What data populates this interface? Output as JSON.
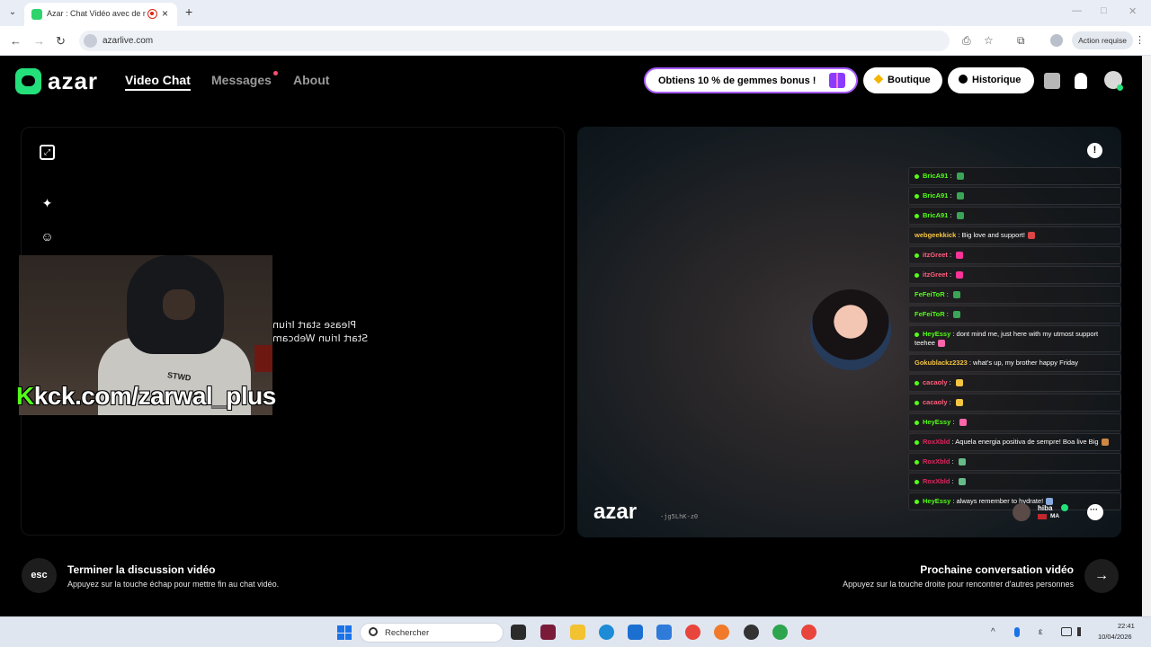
{
  "browser": {
    "tab_title": "Azar : Chat Vidéo avec de n",
    "new_tab": "+",
    "tab_close": "×",
    "menu_glyph": "⌄",
    "back": "←",
    "forward": "→",
    "reload": "↻",
    "url": "azarlive.com",
    "action_required": "Action requise",
    "kebab": "⋮",
    "minimize": "—",
    "maximize": "□",
    "close": "✕",
    "toolbar_glyphs": [
      "⎙",
      "☆",
      "⧉"
    ]
  },
  "header": {
    "logo_text": "azar",
    "nav": [
      {
        "label": "Video Chat"
      },
      {
        "label": "Messages"
      },
      {
        "label": "About"
      }
    ],
    "promo_label": "Obtiens 10 % de gemmes bonus !",
    "shop_label": "Boutique",
    "history_label": "Historique"
  },
  "left_panel": {
    "overlay_link_k": "K",
    "overlay_link_rest": "kck.com/zarwal_plus",
    "sweater_text": "STWD",
    "mirrored_line1": "Please start Iriun",
    "mirrored_line2": "Start Iriun Webcam",
    "expand_glyph": "⤢",
    "magic_glyph": "✦",
    "emoji_glyph": "☺"
  },
  "right_panel": {
    "report_glyph": "!",
    "chat": [
      {
        "user": "BricA91",
        "text": "",
        "color": "#53fc18",
        "emote": "#3aa557"
      },
      {
        "user": "BricA91",
        "text": "",
        "color": "#53fc18",
        "emote": "#3aa557"
      },
      {
        "user": "BricA91",
        "text": "",
        "color": "#53fc18",
        "emote": "#3aa557"
      },
      {
        "user": "webgeekkick",
        "text": "Big love and support!",
        "color": "#f4c542",
        "emote": "#d44",
        "nodot": true
      },
      {
        "user": "itzGreet",
        "text": "",
        "color": "#ff5e7e",
        "emote": "#f39"
      },
      {
        "user": "itzGreet",
        "text": "",
        "color": "#ff5e7e",
        "emote": "#f39"
      },
      {
        "user": "FeFeiToR",
        "text": "",
        "color": "#53fc18",
        "emote": "#3aa557",
        "nodot": true
      },
      {
        "user": "FeFeiToR",
        "text": "",
        "color": "#53fc18",
        "emote": "#3aa557",
        "nodot": true
      },
      {
        "user": "HeyEssy",
        "text": "dont mind me, just here with my utmost support teehee",
        "color": "#53fc18",
        "emote": "#f6a"
      },
      {
        "user": "Gokublackz2323",
        "text": "what's up, my brother happy Friday",
        "color": "#f4c542",
        "emote": "",
        "nodot": true
      },
      {
        "user": "cacaoly",
        "text": "",
        "color": "#ff5e7e",
        "emote": "#f4c542"
      },
      {
        "user": "cacaoly",
        "text": "",
        "color": "#ff5e7e",
        "emote": "#f4c542"
      },
      {
        "user": "HeyEssy",
        "text": "",
        "color": "#53fc18",
        "emote": "#f6a"
      },
      {
        "user": "RoxXbld",
        "text": "Aquela energia positiva de sempre! Boa live Big",
        "color": "#e0245e",
        "emote": "#c84"
      },
      {
        "user": "RoxXbld",
        "text": "",
        "color": "#e0245e",
        "emote": "#6b8"
      },
      {
        "user": "RoxXbld",
        "text": "",
        "color": "#e0245e",
        "emote": "#6b8"
      },
      {
        "user": "HeyEssy",
        "text": "always remember to hydrate!",
        "color": "#53fc18",
        "emote": "#8ad"
      }
    ],
    "watermark_logo": "azar",
    "watermark_id": "-jg5LhK-z0",
    "partner_name": "hiba",
    "partner_country": "MA"
  },
  "controls": {
    "esc_label": "esc",
    "end_title": "Terminer la discussion vidéo",
    "end_sub": "Appuyez sur la touche échap pour mettre fin au chat vidéo.",
    "next_title": "Prochaine conversation vidéo",
    "next_sub": "Appuyez sur la touche droite pour rencontrer d'autres personnes",
    "next_glyph": "→"
  },
  "taskbar": {
    "search_placeholder": "Rechercher",
    "time": "22:41",
    "date": "10/04/2026",
    "chevron": "^",
    "keyboard": "ε"
  },
  "colors": {
    "brand_green": "#24e07a",
    "kick_green": "#53fc18",
    "promo_border": "#a95cff"
  }
}
